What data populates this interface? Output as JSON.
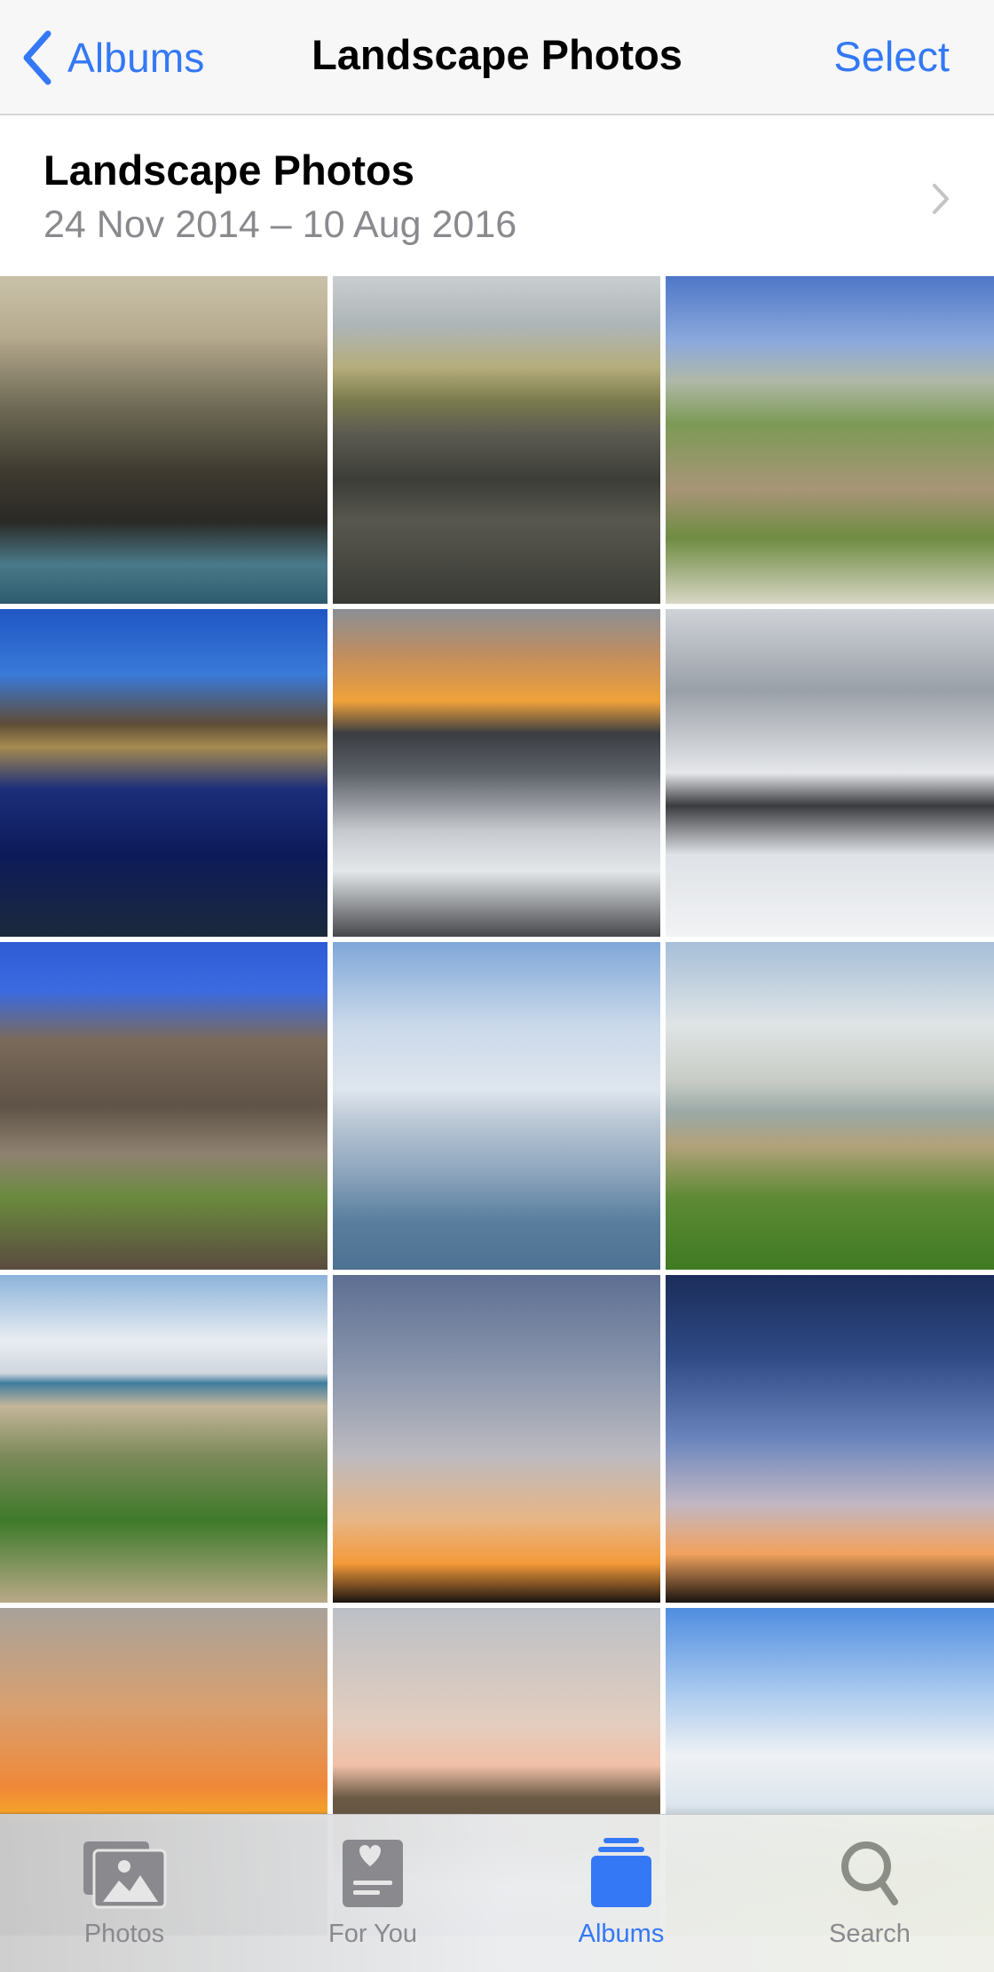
{
  "navbar": {
    "back_label": "Albums",
    "title": "Landscape Photos",
    "select_label": "Select"
  },
  "album": {
    "name": "Landscape Photos",
    "date_range": "24 Nov 2014 – 10 Aug 2016"
  },
  "colors": {
    "accent": "#3478f6",
    "secondary_text": "#8a8a8e",
    "inactive_icon": "#8a8a8e"
  },
  "photos": [
    {
      "subject": "harbour-boats",
      "bg": "linear-gradient(180deg,#c9c2a9 0%,#b7ab8f 18%,#6e6a55 40%,#3e3a30 60%,#2a2a26 75%,#4a7a8a 88%,#2d5b6e 100%)"
    },
    {
      "subject": "stone-wall-grass",
      "bg": "linear-gradient(180deg,#c9ced1 0%,#aeb5b7 15%,#b5ad7a 28%,#7b7b4d 38%,#5c5b52 48%,#3d3d38 62%,#57574f 75%,#3a3a35 100%)"
    },
    {
      "subject": "country-path-church",
      "bg": "linear-gradient(180deg,#4f77c8 0%,#8ba9dc 20%,#b0b8a8 32%,#7c9a55 45%,#a89578 65%,#6f8c42 80%,#d8d6c5 100%)"
    },
    {
      "subject": "mountain-lake-reflection",
      "bg": "linear-gradient(180deg,#1f56c4 0%,#3a7ad8 20%,#5e4c38 35%,#a58b4e 42%,#1c2e7a 55%,#0d1a5a 75%,#1b2a3c 100%)"
    },
    {
      "subject": "sunset-waves",
      "bg": "linear-gradient(180deg,#8a8f95 0%,#c58e5c 15%,#f0a23a 28%,#3a3d42 38%,#5c6168 50%,#c7cacf 68%,#e4e7ea 80%,#45474a 100%)"
    },
    {
      "subject": "snowy-tree-avenue",
      "bg": "linear-gradient(180deg,#cfd3d8 0%,#9aa0a8 25%,#e5e7ea 50%,#3a3c40 60%,#dfe2e6 75%,#f1f3f5 100%)"
    },
    {
      "subject": "giants-causeway",
      "bg": "linear-gradient(180deg,#2e5cd6 0%,#3b6ae0 15%,#7a6a5a 30%,#5f5347 50%,#8f8271 65%,#6a8a3e 78%,#5a4b3f 100%)"
    },
    {
      "subject": "dog-in-sea",
      "bg": "linear-gradient(180deg,#7fa7d8 0%,#c9d8ea 25%,#dfe6ee 45%,#b9c6d4 55%,#8ea6bd 70%,#5a7f9e 85%,#4d7192 100%)"
    },
    {
      "subject": "coastal-beach-grass",
      "bg": "linear-gradient(180deg,#a6bfd8 0%,#dfe4e6 25%,#c9cdc6 42%,#9aa9a6 52%,#b2a27a 62%,#5e8a35 78%,#3f7a22 100%)"
    },
    {
      "subject": "child-on-beach",
      "bg": "linear-gradient(180deg,#8cb3da 0%,#e9edf2 20%,#cfd6de 30%,#3f7c9e 33%,#c4b69a 40%,#7d8a5a 55%,#3e7a2a 75%,#b9a988 100%)"
    },
    {
      "subject": "silhouettes-sunset-1",
      "bg": "linear-gradient(180deg,#5d6f92 0%,#8c97ae 30%,#bcbac0 55%,#e8b584 75%,#f49a3a 88%,#1a1410 100%)"
    },
    {
      "subject": "silhouettes-sunset-2",
      "bg": "linear-gradient(180deg,#1b2d5a 0%,#2f4a85 25%,#6a85bd 50%,#c2b7c3 70%,#f2a25e 85%,#1a1410 100%)"
    },
    {
      "subject": "sun-over-sea",
      "bg": "linear-gradient(180deg,#a8a29a 0%,#d8a070 30%,#f08838 55%,#f5a02a 62%,#2e2b2b 66%,#1f1f22 100%)"
    },
    {
      "subject": "lighthouse-waves",
      "bg": "linear-gradient(180deg,#bcc0c6 0%,#e3cdbf 35%,#f1c0a7 48%,#6a5a45 58%,#5b4e3f 72%,#d8e0ea 85%,#7f95ad 100%)"
    },
    {
      "subject": "horse-on-hills",
      "bg": "linear-gradient(180deg,#4f8de0 0%,#a7c8ee 25%,#eef1f4 45%,#dde6ee 60%,#8a9aa0 70%,#6c8a3a 82%,#a2a85a 100%)"
    }
  ],
  "tabbar": {
    "tabs": [
      {
        "label": "Photos",
        "icon": "photos-icon",
        "active": false
      },
      {
        "label": "For You",
        "icon": "for-you-icon",
        "active": false
      },
      {
        "label": "Albums",
        "icon": "albums-icon",
        "active": true
      },
      {
        "label": "Search",
        "icon": "search-icon",
        "active": false
      }
    ]
  }
}
